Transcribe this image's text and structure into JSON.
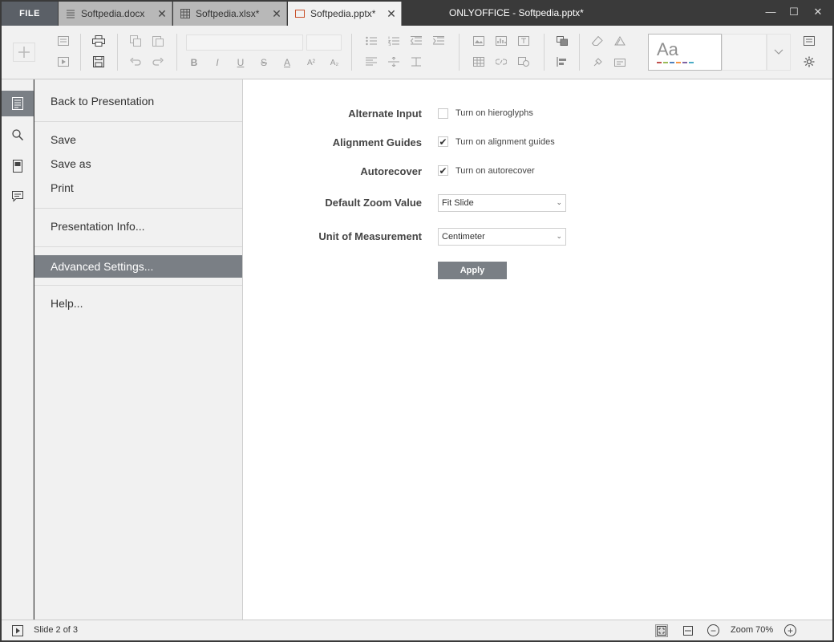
{
  "window": {
    "title": "ONLYOFFICE - Softpedia.pptx*",
    "minimize_glyph": "—",
    "maximize_glyph": "☐",
    "close_glyph": "✕"
  },
  "file_button": "FILE",
  "tabs": [
    {
      "label": "Softpedia.docx",
      "icon": "document-icon",
      "close": "✕"
    },
    {
      "label": "Softpedia.xlsx*",
      "icon": "spreadsheet-icon",
      "close": "✕"
    },
    {
      "label": "Softpedia.pptx*",
      "icon": "presentation-icon",
      "close": "✕",
      "active": true
    }
  ],
  "toolbar": {
    "format_buttons": {
      "bold": "B",
      "italic": "I",
      "underline": "U",
      "strikethrough": "S",
      "font_color": "A",
      "superscript": "A²",
      "subscript": "A₂"
    },
    "theme_preview": "Aa",
    "theme_colors": [
      "#c0504d",
      "#9bbb59",
      "#4f81bd",
      "#f79646",
      "#8064a2",
      "#4bacc6"
    ]
  },
  "file_menu": {
    "items": [
      {
        "label": "Back to Presentation"
      },
      {
        "label": "Save"
      },
      {
        "label": "Save as"
      },
      {
        "label": "Print"
      },
      {
        "label": "Presentation Info..."
      },
      {
        "label": "Advanced Settings...",
        "active": true
      },
      {
        "label": "Help..."
      }
    ]
  },
  "settings": {
    "alternate_input": {
      "label": "Alternate Input",
      "option": "Turn on hieroglyphs",
      "checked": false
    },
    "alignment_guides": {
      "label": "Alignment Guides",
      "option": "Turn on alignment guides",
      "checked": true
    },
    "autorecover": {
      "label": "Autorecover",
      "option": "Turn on autorecover",
      "checked": true
    },
    "default_zoom": {
      "label": "Default Zoom Value",
      "value": "Fit Slide"
    },
    "unit": {
      "label": "Unit of Measurement",
      "value": "Centimeter"
    },
    "apply_label": "Apply",
    "check_glyph": "✔"
  },
  "status": {
    "slide_info": "Slide 2 of 3",
    "zoom": "Zoom 70%",
    "zoom_out": "−",
    "zoom_in": "+"
  }
}
